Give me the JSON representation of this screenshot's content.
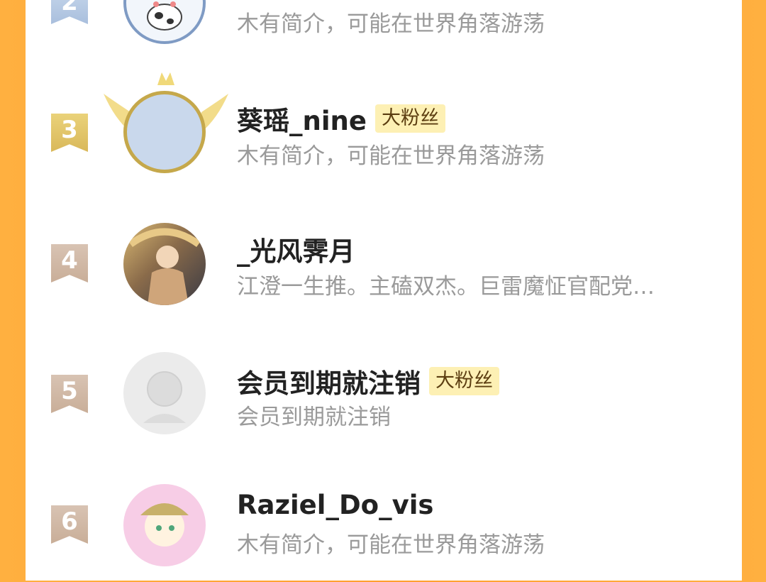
{
  "list": [
    {
      "rank": "2",
      "name": "",
      "badge": "",
      "bio": "木有简介，可能在世界角落游荡"
    },
    {
      "rank": "3",
      "name": "葵瑶_nine",
      "badge": "大粉丝",
      "bio": "木有简介，可能在世界角落游荡"
    },
    {
      "rank": "4",
      "name": "_光风霁月",
      "badge": "",
      "bio": "江澄一生推。主磕双杰。巨雷魔怔官配党…"
    },
    {
      "rank": "5",
      "name": "会员到期就注销",
      "badge": "大粉丝",
      "bio": "会员到期就注销"
    },
    {
      "rank": "6",
      "name": "Raziel_Do_vis",
      "badge": "",
      "bio": "木有简介，可能在世界角落游荡"
    }
  ],
  "colors": {
    "background": "#ff9f2e",
    "badge_bg": "#fdf0b4",
    "rank_gold": "#d9b85a",
    "rank_silver": "#a9bfdd",
    "rank_plain": "#c9ae98"
  }
}
